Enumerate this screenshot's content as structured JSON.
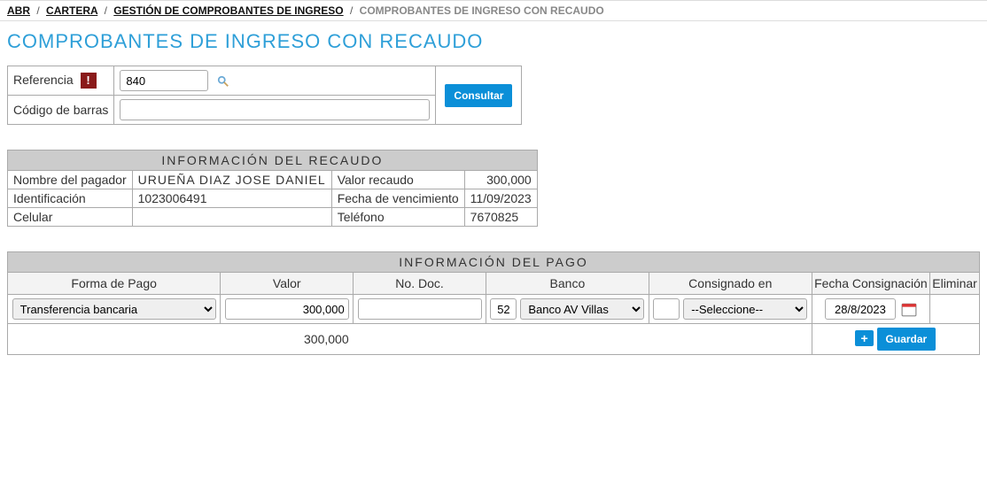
{
  "breadcrumb": {
    "items": [
      "ABR",
      "CARTERA",
      "GESTIÓN DE COMPROBANTES DE INGRESO"
    ],
    "current": "COMPROBANTES DE INGRESO CON RECAUDO"
  },
  "title": "COMPROBANTES DE INGRESO CON RECAUDO",
  "search": {
    "ref_label": "Referencia",
    "ref_value": "840",
    "barcode_label": "Código de barras",
    "barcode_value": "",
    "consult_label": "Consultar"
  },
  "recaudo": {
    "header": "INFORMACIÓN DEL RECAUDO",
    "rows": {
      "nombre_label": "Nombre del pagador",
      "nombre_value": "URUEÑA DIAZ JOSE DANIEL",
      "valor_label": "Valor recaudo",
      "valor_value": "300,000",
      "ident_label": "Identificación",
      "ident_value": "1023006491",
      "fvenc_label": "Fecha de vencimiento",
      "fvenc_value": "11/09/2023",
      "cel_label": "Celular",
      "cel_value": "",
      "tel_label": "Teléfono",
      "tel_value": "7670825"
    }
  },
  "pago": {
    "header": "INFORMACIÓN DEL PAGO",
    "cols": {
      "forma": "Forma de Pago",
      "valor": "Valor",
      "doc": "No. Doc.",
      "banco": "Banco",
      "consignado": "Consignado en",
      "fecha": "Fecha Consignación",
      "eliminar": "Eliminar"
    },
    "row": {
      "forma_value": "Transferencia bancaria",
      "valor_value": "300,000",
      "doc_value": "",
      "banco_code": "52",
      "banco_select": "Banco AV Villas",
      "consignado_code": "",
      "consignado_select": "--Seleccione--",
      "fecha_value": "28/8/2023"
    },
    "total": "300,000",
    "add_label": "+",
    "save_label": "Guardar"
  }
}
